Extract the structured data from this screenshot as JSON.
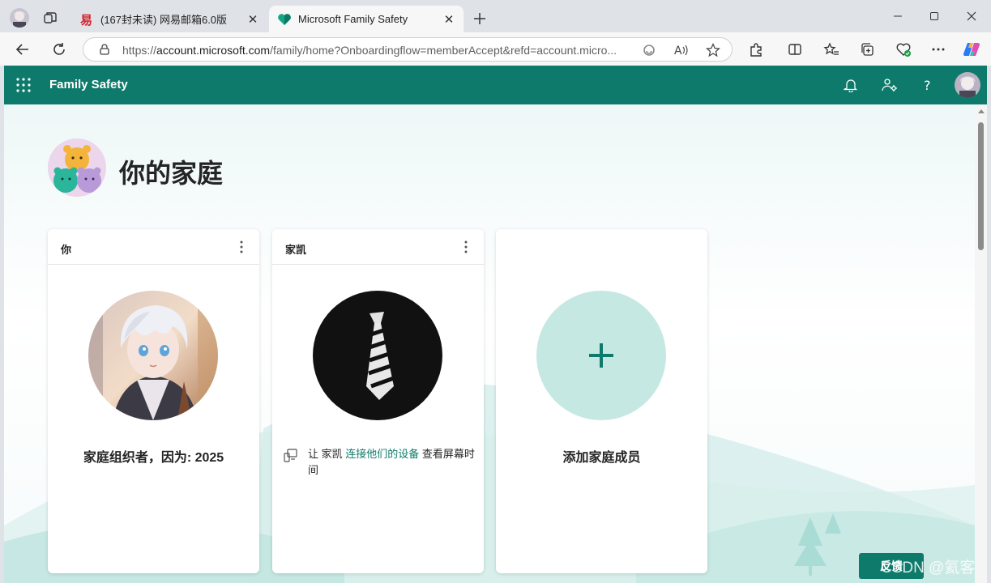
{
  "browser": {
    "tabs": [
      {
        "title": "(167封未读) 网易邮箱6.0版",
        "active": false,
        "favicon": "netease-mail-icon"
      },
      {
        "title": "Microsoft Family Safety",
        "active": true,
        "favicon": "family-safety-heart-icon"
      }
    ],
    "address": {
      "protocol": "https://",
      "host": "account.microsoft.com",
      "path": "/family/home?Onboardingflow=memberAccept&refd=account.micro..."
    },
    "window_controls": [
      "minimize-icon",
      "maximize-icon",
      "close-icon"
    ]
  },
  "app": {
    "title": "Family Safety",
    "header_icons": [
      "notifications-icon",
      "family-settings-icon",
      "help-icon",
      "profile-avatar"
    ]
  },
  "page": {
    "title": "你的家庭",
    "cards": [
      {
        "name": "你",
        "caption": "家庭组织者，因为: 2025",
        "picture": "anime-avatar"
      },
      {
        "name": "家凯",
        "note_prefix": "让 家凯 ",
        "note_link": "连接他们的设备",
        "note_suffix": " 查看屏幕时间",
        "picture": "necktie-avatar"
      },
      {
        "caption": "添加家庭成员",
        "picture": "add-member-plus"
      }
    ],
    "feedback_label": "反馈",
    "watermark": "CSDN @氦客"
  },
  "colors": {
    "brand": "#0e7a6b",
    "add_circle": "#c6e8e3",
    "link": "#0e7a6b"
  }
}
